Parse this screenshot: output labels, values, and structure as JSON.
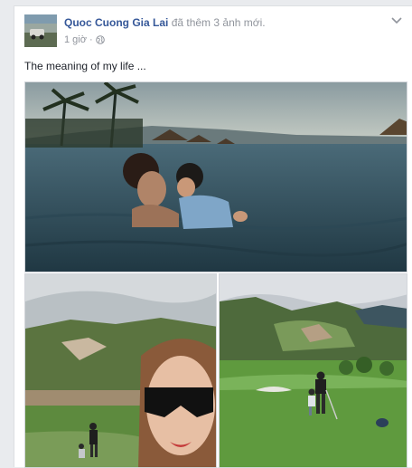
{
  "post": {
    "author_name": "Quoc Cuong Gia Lai",
    "action_text": "đã thêm 3 ảnh mới.",
    "timestamp": "1 giờ",
    "separator": "·",
    "audience_icon": "globe-icon",
    "caption": "The meaning of my life ...",
    "menu_icon": "chevron-down-icon",
    "photos": [
      {
        "subject": "infinity-pool"
      },
      {
        "subject": "selfie-mountains"
      },
      {
        "subject": "golf-course"
      }
    ]
  },
  "colors": {
    "link": "#365899",
    "secondary_text": "#90949c",
    "body_text": "#1d2129",
    "page_bg": "#e9ebee"
  }
}
